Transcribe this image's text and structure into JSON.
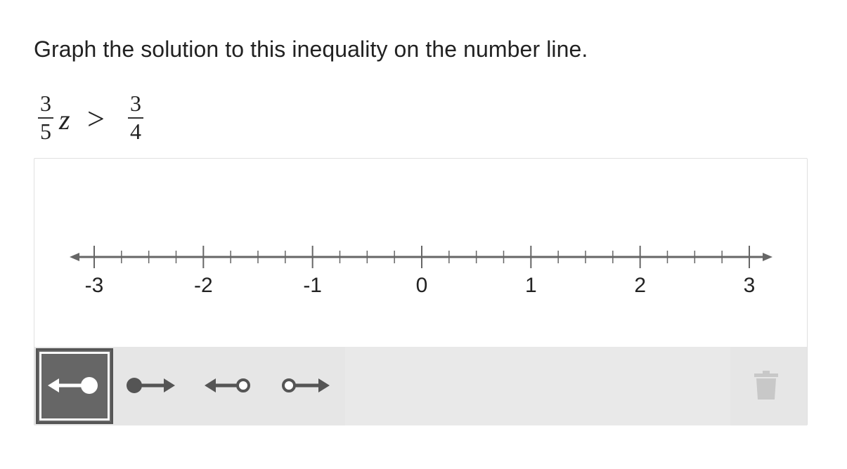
{
  "prompt": "Graph the solution to this inequality on the number line.",
  "inequality": {
    "left_numerator": "3",
    "left_denominator": "5",
    "variable": "z",
    "operator": ">",
    "right_numerator": "3",
    "right_denominator": "4"
  },
  "number_line": {
    "min": -3,
    "max": 3,
    "labels": [
      "-3",
      "-2",
      "-1",
      "0",
      "1",
      "2",
      "3"
    ],
    "minor_ticks_per_unit": 4
  },
  "toolbar": {
    "tools": [
      {
        "name": "closed-left-ray-tool",
        "icon": "closed-dot-left-arrow-icon",
        "selected": true
      },
      {
        "name": "closed-right-ray-tool",
        "icon": "closed-dot-right-arrow-icon",
        "selected": false
      },
      {
        "name": "open-left-ray-tool",
        "icon": "open-dot-left-arrow-icon",
        "selected": false
      },
      {
        "name": "open-right-ray-tool",
        "icon": "open-dot-right-arrow-icon",
        "selected": false
      }
    ],
    "delete_icon": "trash-icon"
  },
  "colors": {
    "line": "#666666",
    "tool_selected_bg": "#666666",
    "toolbar_bg": "#e6e6e6",
    "trash_disabled": "#c8c8c8"
  }
}
